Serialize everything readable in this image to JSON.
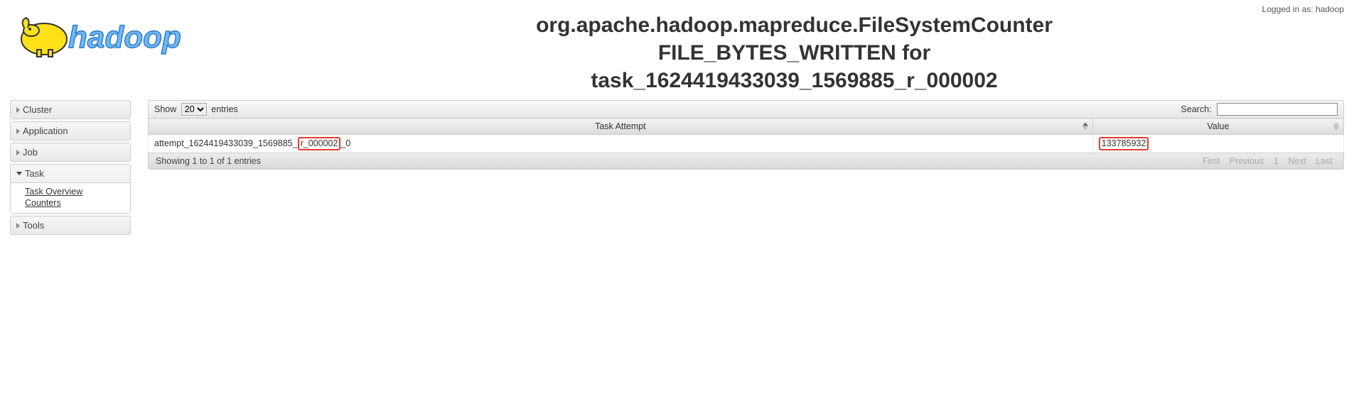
{
  "loggedin_prefix": "Logged in as: ",
  "loggedin_user": "hadoop",
  "title_line1": "org.apache.hadoop.mapreduce.FileSystemCounter",
  "title_line2": "FILE_BYTES_WRITTEN for",
  "title_line3": "task_1624419433039_1569885_r_000002",
  "sidebar": {
    "cluster": "Cluster",
    "application": "Application",
    "job": "Job",
    "task": "Task",
    "task_items": {
      "overview": "Task Overview",
      "counters": "Counters"
    },
    "tools": "Tools"
  },
  "dt": {
    "show_label_pre": "Show",
    "show_label_post": "entries",
    "page_size": "20",
    "search_label": "Search:",
    "col_attempt": "Task Attempt",
    "col_value": "Value",
    "row": {
      "attempt_pre": "attempt_1624419433039_1569885_",
      "attempt_hl": "r_000002",
      "attempt_post": "_0",
      "value": "133785932"
    },
    "info": "Showing 1 to 1 of 1 entries",
    "pager": {
      "first": "First",
      "prev": "Previous",
      "page": "1",
      "next": "Next",
      "last": "Last"
    }
  }
}
